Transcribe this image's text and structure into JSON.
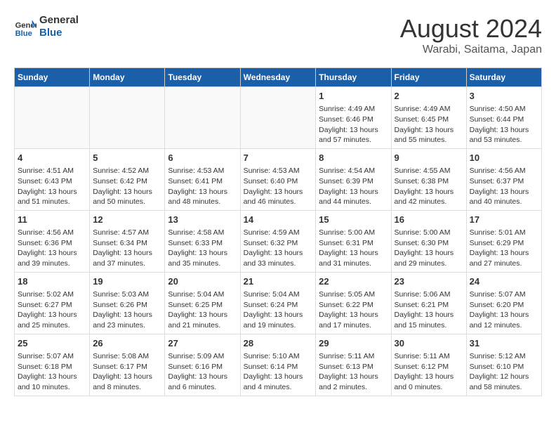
{
  "header": {
    "logo_line1": "General",
    "logo_line2": "Blue",
    "month": "August 2024",
    "location": "Warabi, Saitama, Japan"
  },
  "days_of_week": [
    "Sunday",
    "Monday",
    "Tuesday",
    "Wednesday",
    "Thursday",
    "Friday",
    "Saturday"
  ],
  "weeks": [
    [
      {
        "day": "",
        "text": ""
      },
      {
        "day": "",
        "text": ""
      },
      {
        "day": "",
        "text": ""
      },
      {
        "day": "",
        "text": ""
      },
      {
        "day": "1",
        "text": "Sunrise: 4:49 AM\nSunset: 6:46 PM\nDaylight: 13 hours\nand 57 minutes."
      },
      {
        "day": "2",
        "text": "Sunrise: 4:49 AM\nSunset: 6:45 PM\nDaylight: 13 hours\nand 55 minutes."
      },
      {
        "day": "3",
        "text": "Sunrise: 4:50 AM\nSunset: 6:44 PM\nDaylight: 13 hours\nand 53 minutes."
      }
    ],
    [
      {
        "day": "4",
        "text": "Sunrise: 4:51 AM\nSunset: 6:43 PM\nDaylight: 13 hours\nand 51 minutes."
      },
      {
        "day": "5",
        "text": "Sunrise: 4:52 AM\nSunset: 6:42 PM\nDaylight: 13 hours\nand 50 minutes."
      },
      {
        "day": "6",
        "text": "Sunrise: 4:53 AM\nSunset: 6:41 PM\nDaylight: 13 hours\nand 48 minutes."
      },
      {
        "day": "7",
        "text": "Sunrise: 4:53 AM\nSunset: 6:40 PM\nDaylight: 13 hours\nand 46 minutes."
      },
      {
        "day": "8",
        "text": "Sunrise: 4:54 AM\nSunset: 6:39 PM\nDaylight: 13 hours\nand 44 minutes."
      },
      {
        "day": "9",
        "text": "Sunrise: 4:55 AM\nSunset: 6:38 PM\nDaylight: 13 hours\nand 42 minutes."
      },
      {
        "day": "10",
        "text": "Sunrise: 4:56 AM\nSunset: 6:37 PM\nDaylight: 13 hours\nand 40 minutes."
      }
    ],
    [
      {
        "day": "11",
        "text": "Sunrise: 4:56 AM\nSunset: 6:36 PM\nDaylight: 13 hours\nand 39 minutes."
      },
      {
        "day": "12",
        "text": "Sunrise: 4:57 AM\nSunset: 6:34 PM\nDaylight: 13 hours\nand 37 minutes."
      },
      {
        "day": "13",
        "text": "Sunrise: 4:58 AM\nSunset: 6:33 PM\nDaylight: 13 hours\nand 35 minutes."
      },
      {
        "day": "14",
        "text": "Sunrise: 4:59 AM\nSunset: 6:32 PM\nDaylight: 13 hours\nand 33 minutes."
      },
      {
        "day": "15",
        "text": "Sunrise: 5:00 AM\nSunset: 6:31 PM\nDaylight: 13 hours\nand 31 minutes."
      },
      {
        "day": "16",
        "text": "Sunrise: 5:00 AM\nSunset: 6:30 PM\nDaylight: 13 hours\nand 29 minutes."
      },
      {
        "day": "17",
        "text": "Sunrise: 5:01 AM\nSunset: 6:29 PM\nDaylight: 13 hours\nand 27 minutes."
      }
    ],
    [
      {
        "day": "18",
        "text": "Sunrise: 5:02 AM\nSunset: 6:27 PM\nDaylight: 13 hours\nand 25 minutes."
      },
      {
        "day": "19",
        "text": "Sunrise: 5:03 AM\nSunset: 6:26 PM\nDaylight: 13 hours\nand 23 minutes."
      },
      {
        "day": "20",
        "text": "Sunrise: 5:04 AM\nSunset: 6:25 PM\nDaylight: 13 hours\nand 21 minutes."
      },
      {
        "day": "21",
        "text": "Sunrise: 5:04 AM\nSunset: 6:24 PM\nDaylight: 13 hours\nand 19 minutes."
      },
      {
        "day": "22",
        "text": "Sunrise: 5:05 AM\nSunset: 6:22 PM\nDaylight: 13 hours\nand 17 minutes."
      },
      {
        "day": "23",
        "text": "Sunrise: 5:06 AM\nSunset: 6:21 PM\nDaylight: 13 hours\nand 15 minutes."
      },
      {
        "day": "24",
        "text": "Sunrise: 5:07 AM\nSunset: 6:20 PM\nDaylight: 13 hours\nand 12 minutes."
      }
    ],
    [
      {
        "day": "25",
        "text": "Sunrise: 5:07 AM\nSunset: 6:18 PM\nDaylight: 13 hours\nand 10 minutes."
      },
      {
        "day": "26",
        "text": "Sunrise: 5:08 AM\nSunset: 6:17 PM\nDaylight: 13 hours\nand 8 minutes."
      },
      {
        "day": "27",
        "text": "Sunrise: 5:09 AM\nSunset: 6:16 PM\nDaylight: 13 hours\nand 6 minutes."
      },
      {
        "day": "28",
        "text": "Sunrise: 5:10 AM\nSunset: 6:14 PM\nDaylight: 13 hours\nand 4 minutes."
      },
      {
        "day": "29",
        "text": "Sunrise: 5:11 AM\nSunset: 6:13 PM\nDaylight: 13 hours\nand 2 minutes."
      },
      {
        "day": "30",
        "text": "Sunrise: 5:11 AM\nSunset: 6:12 PM\nDaylight: 13 hours\nand 0 minutes."
      },
      {
        "day": "31",
        "text": "Sunrise: 5:12 AM\nSunset: 6:10 PM\nDaylight: 12 hours\nand 58 minutes."
      }
    ]
  ]
}
